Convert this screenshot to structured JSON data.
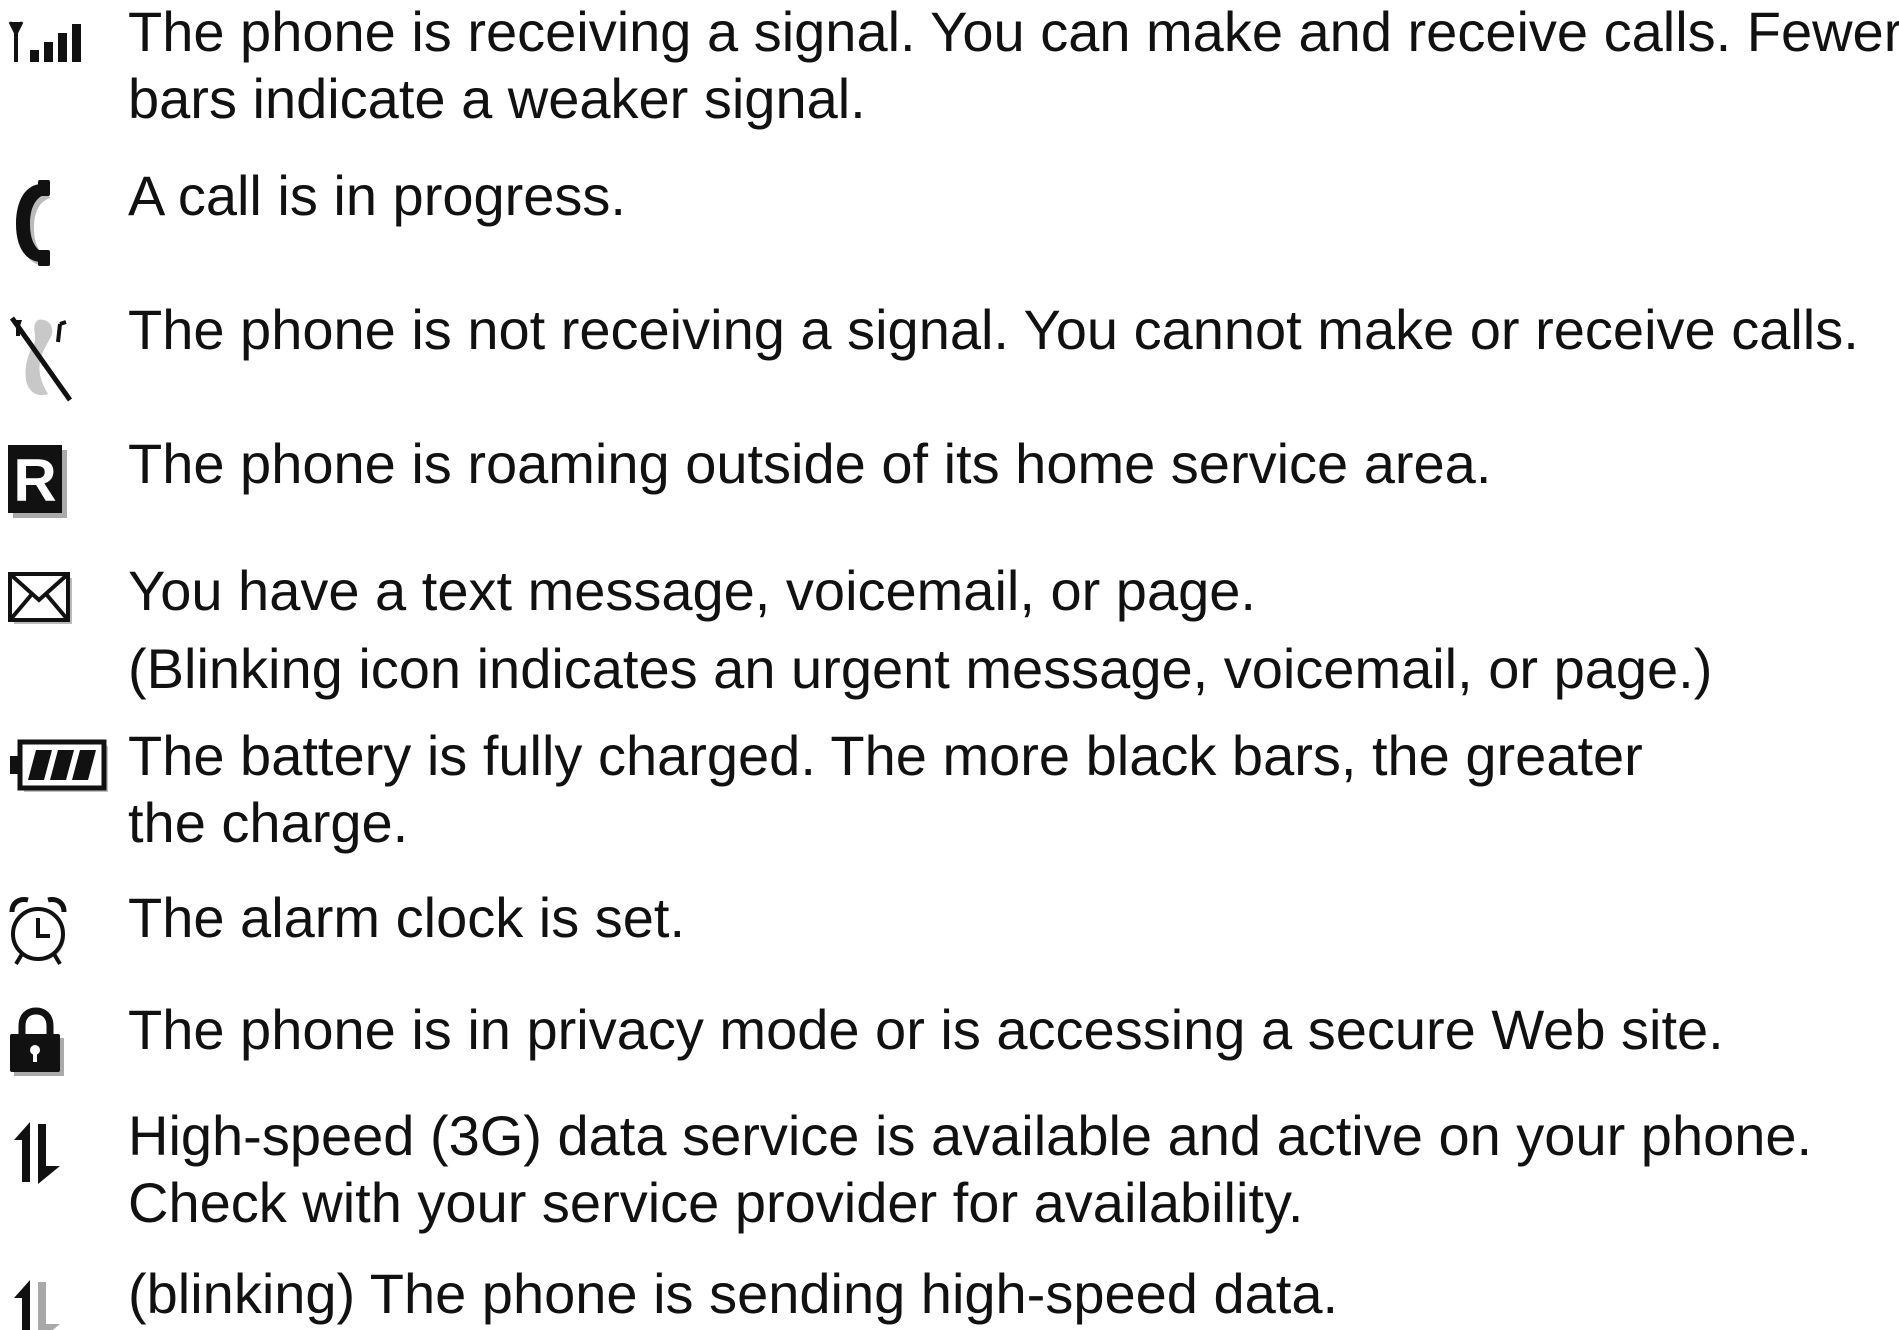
{
  "legend": {
    "items": [
      {
        "icon": "signal-strength-icon",
        "lines": [
          "The phone is receiving a signal. You can make and receive calls. Fewer",
          "bars indicate a weaker signal."
        ]
      },
      {
        "icon": "call-in-progress-icon",
        "lines": [
          "A call is in progress."
        ]
      },
      {
        "icon": "no-signal-icon",
        "lines": [
          "The phone is not receiving a signal. You cannot make or receive calls."
        ]
      },
      {
        "icon": "roaming-icon",
        "icon_letter": "R",
        "lines": [
          "The phone is roaming outside of its home service area."
        ]
      },
      {
        "icon": "message-envelope-icon",
        "lines": [
          "You have a text message, voicemail, or page.",
          "(Blinking icon indicates an urgent message, voicemail, or page.)"
        ]
      },
      {
        "icon": "battery-full-icon",
        "lines": [
          "The battery is fully charged. The more black bars, the greater",
          "the charge."
        ]
      },
      {
        "icon": "alarm-clock-icon",
        "lines": [
          "The alarm clock is set."
        ]
      },
      {
        "icon": "lock-icon",
        "lines": [
          "The phone is in privacy mode or is accessing a secure Web site."
        ]
      },
      {
        "icon": "data-active-icon",
        "lines": [
          "High-speed (3G) data service is available and active on your phone.",
          "Check with your service provider for availability."
        ]
      },
      {
        "icon": "data-sending-icon",
        "lines": [
          "(blinking) The phone is sending high-speed data."
        ]
      }
    ]
  }
}
